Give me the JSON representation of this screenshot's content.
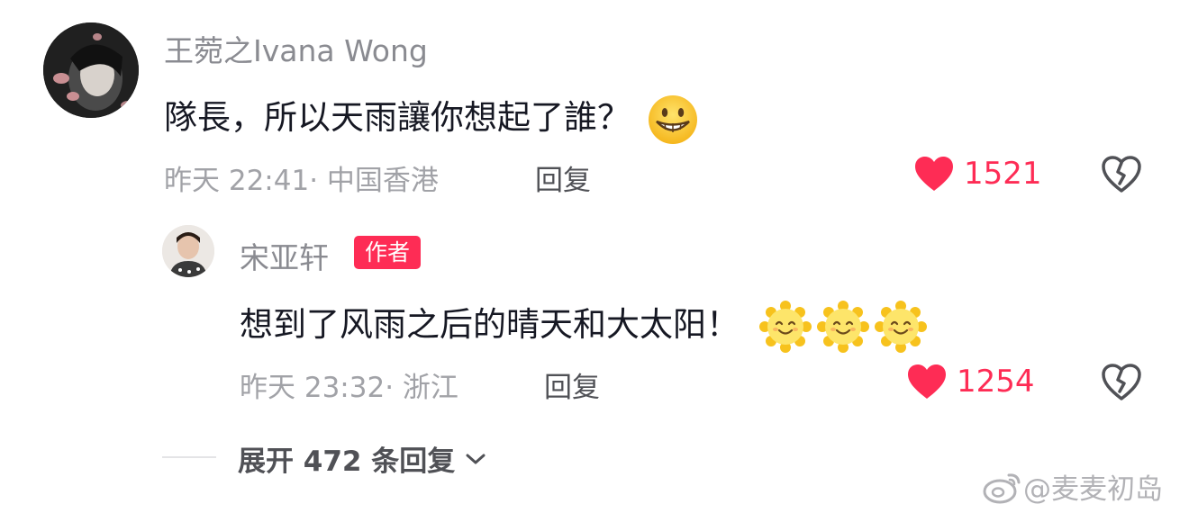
{
  "comment": {
    "username": "王菀之Ivana Wong",
    "text": "隊長，所以天雨讓你想起了誰？",
    "time": "昨天 22:41",
    "location": "· 中国香港",
    "reply_label": "回复",
    "likes": "1521",
    "emoji": "grinning-face"
  },
  "reply": {
    "username": "宋亚轩",
    "badge": "作者",
    "text": "想到了风雨之后的晴天和大太阳！",
    "time": "昨天 23:32",
    "location": "· 浙江",
    "reply_label": "回复",
    "likes": "1254",
    "emojis": [
      "sun-with-face",
      "sun-with-face",
      "sun-with-face"
    ]
  },
  "expand": {
    "label": "展开 472 条回复"
  },
  "watermark": {
    "text": "@麦麦初岛"
  },
  "colors": {
    "like_red": "#fe2c55",
    "text_primary": "#161823",
    "text_secondary": "#a1a2a7"
  }
}
